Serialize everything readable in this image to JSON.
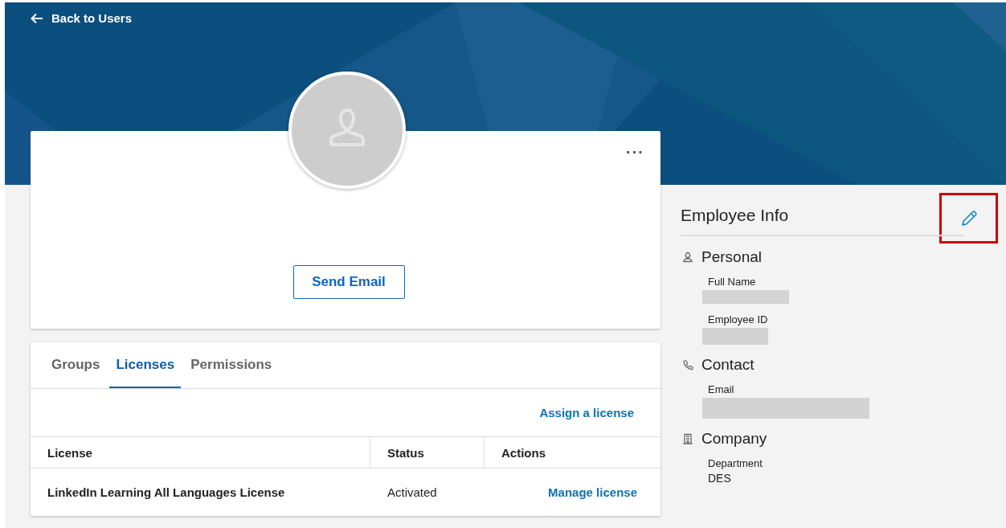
{
  "back_link": {
    "label": "Back to Users"
  },
  "profile_card": {
    "avatar": {
      "kind": "placeholder"
    },
    "more_menu": "···",
    "send_email_button": "Send Email"
  },
  "tabs": [
    {
      "label": "Groups",
      "selected": false
    },
    {
      "label": "Licenses",
      "selected": true
    },
    {
      "label": "Permissions",
      "selected": false
    }
  ],
  "assign_link": "Assign a license",
  "table": {
    "columns": [
      "License",
      "Status",
      "Actions"
    ],
    "rows": [
      {
        "license": "LinkedIn Learning All Languages License",
        "status": "Activated",
        "action": "Manage license"
      }
    ]
  },
  "employee_info": {
    "title": "Employee Info",
    "edit_button": {
      "highlighted": true
    },
    "sections": [
      {
        "kind": "person",
        "title": "Personal",
        "fields": [
          {
            "label": "Full Name",
            "kind": "redacted"
          },
          {
            "label": "Employee ID",
            "kind": "redacted"
          }
        ]
      },
      {
        "kind": "phone",
        "title": "Contact",
        "fields": [
          {
            "label": "Email",
            "kind": "redacted"
          }
        ]
      },
      {
        "kind": "building",
        "title": "Company",
        "fields": [
          {
            "label": "Department",
            "kind": "text",
            "value": "DES"
          }
        ]
      }
    ]
  }
}
